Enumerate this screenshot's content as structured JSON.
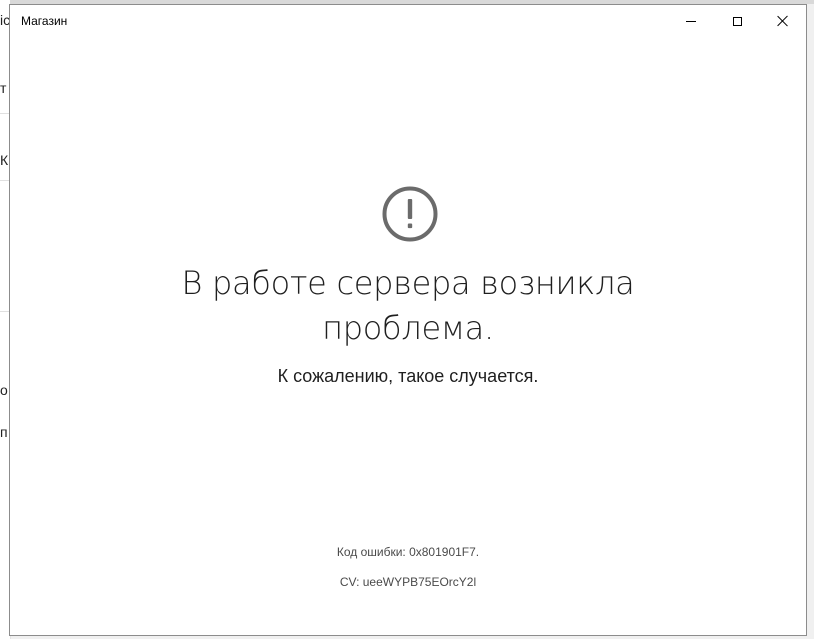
{
  "background_window": {
    "glyphs": [
      "ic",
      "т",
      "К",
      "о",
      "п"
    ]
  },
  "window": {
    "title": "Магазин"
  },
  "error": {
    "icon": "exclamation-circle-icon",
    "headline_line1": "В работе сервера возникла",
    "headline_line2": "проблема.",
    "subtitle": "К сожалению, такое случается.",
    "error_code": "Код ошибки: 0x801901F7.",
    "cv": "CV: ueeWYPB75EOrcY2l"
  },
  "colors": {
    "text": "#1f1f1f",
    "icon": "#6b6b6b",
    "border": "#8c8c8c"
  }
}
